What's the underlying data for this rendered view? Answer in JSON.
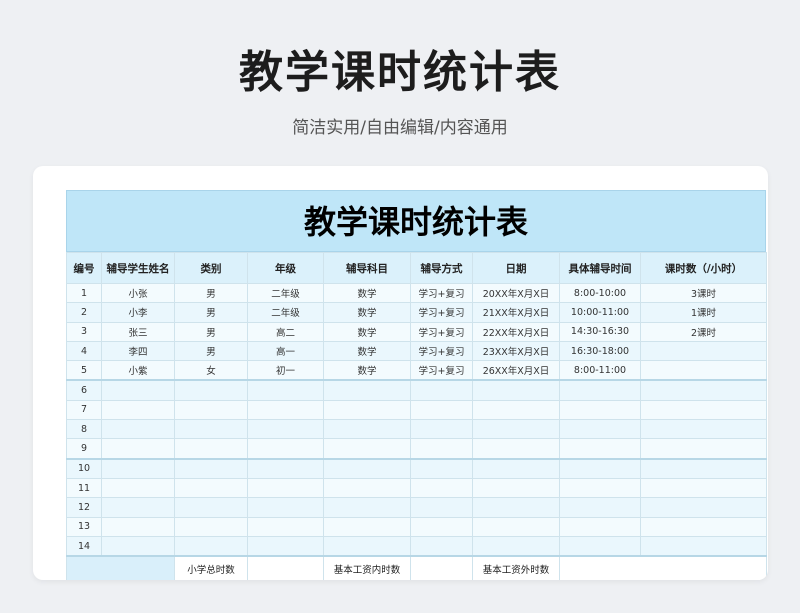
{
  "header": {
    "title": "教学课时统计表",
    "subtitle": "简洁实用/自由编辑/内容通用"
  },
  "sheet": {
    "title": "教学课时统计表",
    "columns": [
      "编号",
      "辅导学生姓名",
      "类别",
      "年级",
      "辅导科目",
      "辅导方式",
      "日期",
      "具体辅导时间",
      "课时数（/小时）"
    ],
    "rows": [
      [
        "1",
        "小张",
        "男",
        "二年级",
        "数学",
        "学习+复习",
        "20XX年X月X日",
        "8:00-10:00",
        "3课时"
      ],
      [
        "2",
        "小李",
        "男",
        "二年级",
        "数学",
        "学习+复习",
        "21XX年X月X日",
        "10:00-11:00",
        "1课时"
      ],
      [
        "3",
        "张三",
        "男",
        "高二",
        "数学",
        "学习+复习",
        "22XX年X月X日",
        "14:30-16:30",
        "2课时"
      ],
      [
        "4",
        "李四",
        "男",
        "高一",
        "数学",
        "学习+复习",
        "23XX年X月X日",
        "16:30-18:00",
        ""
      ],
      [
        "5",
        "小紫",
        "女",
        "初一",
        "数学",
        "学习+复习",
        "26XX年X月X日",
        "8:00-11:00",
        ""
      ],
      [
        "6",
        "",
        "",
        "",
        "",
        "",
        "",
        "",
        ""
      ],
      [
        "7",
        "",
        "",
        "",
        "",
        "",
        "",
        "",
        ""
      ],
      [
        "8",
        "",
        "",
        "",
        "",
        "",
        "",
        "",
        ""
      ],
      [
        "9",
        "",
        "",
        "",
        "",
        "",
        "",
        "",
        ""
      ],
      [
        "10",
        "",
        "",
        "",
        "",
        "",
        "",
        "",
        ""
      ],
      [
        "11",
        "",
        "",
        "",
        "",
        "",
        "",
        "",
        ""
      ],
      [
        "12",
        "",
        "",
        "",
        "",
        "",
        "",
        "",
        ""
      ],
      [
        "13",
        "",
        "",
        "",
        "",
        "",
        "",
        "",
        ""
      ],
      [
        "14",
        "",
        "",
        "",
        "",
        "",
        "",
        "",
        ""
      ]
    ],
    "footer": {
      "primary_total_label": "小学总时数",
      "base_in_label": "基本工资内时数",
      "base_out_label": "基本工资外时数"
    }
  },
  "colors": {
    "title_band": "#bfe6f8",
    "header_row": "#dbf1fb",
    "row_light": "#f3fbfe",
    "row_alt": "#eaf7fd"
  }
}
